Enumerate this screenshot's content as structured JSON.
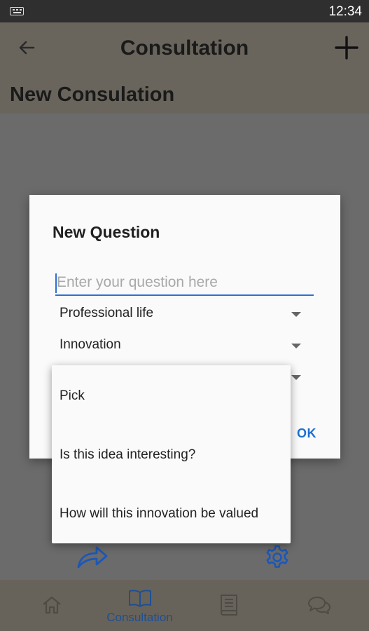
{
  "status_bar": {
    "time": "12:34",
    "keyboard_icon": "keyboard-icon"
  },
  "app_bar": {
    "title": "Consultation",
    "back_icon": "arrow-left-icon",
    "add_icon": "plus-icon"
  },
  "sub_header": {
    "title": "New Consulation"
  },
  "dialog": {
    "title": "New Question",
    "question_input": {
      "value": "",
      "placeholder": "Enter your question here"
    },
    "spinners": [
      {
        "selected": "Professional life"
      },
      {
        "selected": "Innovation"
      },
      {
        "selected": ""
      }
    ],
    "ok_label": "OK"
  },
  "popup": {
    "options": [
      "Pick",
      "Is this idea interesting?",
      "How will this innovation be valued"
    ]
  },
  "actions": {
    "share_icon": "share-icon",
    "settings_icon": "gear-icon"
  },
  "bottom_nav": {
    "items": [
      {
        "icon": "home-icon",
        "label": ""
      },
      {
        "icon": "book-open-icon",
        "label": "Consultation"
      },
      {
        "icon": "book-icon",
        "label": ""
      },
      {
        "icon": "chat-icon",
        "label": ""
      }
    ]
  },
  "colors": {
    "accent": "#1c6fd3",
    "app_bar": "#6a655c",
    "nav_active": "#1d4f93"
  }
}
